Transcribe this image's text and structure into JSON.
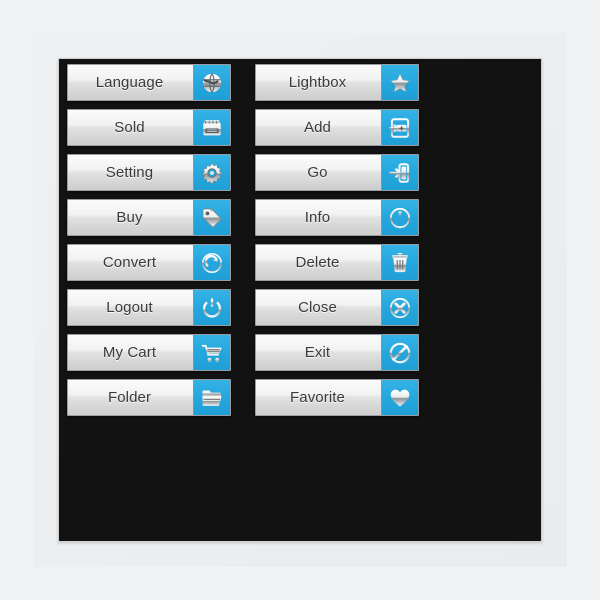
{
  "panel": {
    "background_color": "#121212",
    "card_color": "#edeef0"
  },
  "theme": {
    "accent_color": "#24a6dd",
    "button_face_top": "#fbfbfb",
    "button_face_bottom": "#cfcfcf",
    "label_text_color": "#3b3b3b",
    "icon_color": "#e9ebec"
  },
  "columns": [
    {
      "name": "left-column",
      "buttons": [
        {
          "label": "Language",
          "icon": "globe-icon"
        },
        {
          "label": "Sold",
          "icon": "shop-front-icon"
        },
        {
          "label": "Setting",
          "icon": "gear-icon"
        },
        {
          "label": "Buy",
          "icon": "price-tag-icon"
        },
        {
          "label": "Convert",
          "icon": "refresh-circle-icon"
        },
        {
          "label": "Logout",
          "icon": "power-icon"
        },
        {
          "label": "My Cart",
          "icon": "shopping-cart-icon"
        },
        {
          "label": "Folder",
          "icon": "folder-icon"
        }
      ]
    },
    {
      "name": "right-column",
      "buttons": [
        {
          "label": "Lightbox",
          "icon": "star-icon"
        },
        {
          "label": "Add",
          "icon": "add-box-icon"
        },
        {
          "label": "Go",
          "icon": "arrow-into-door-icon"
        },
        {
          "label": "Info",
          "icon": "info-circle-icon"
        },
        {
          "label": "Delete",
          "icon": "trash-bin-icon"
        },
        {
          "label": "Close",
          "icon": "close-circle-icon"
        },
        {
          "label": "Exit",
          "icon": "no-entry-icon"
        },
        {
          "label": "Favorite",
          "icon": "heart-icon"
        }
      ]
    }
  ]
}
